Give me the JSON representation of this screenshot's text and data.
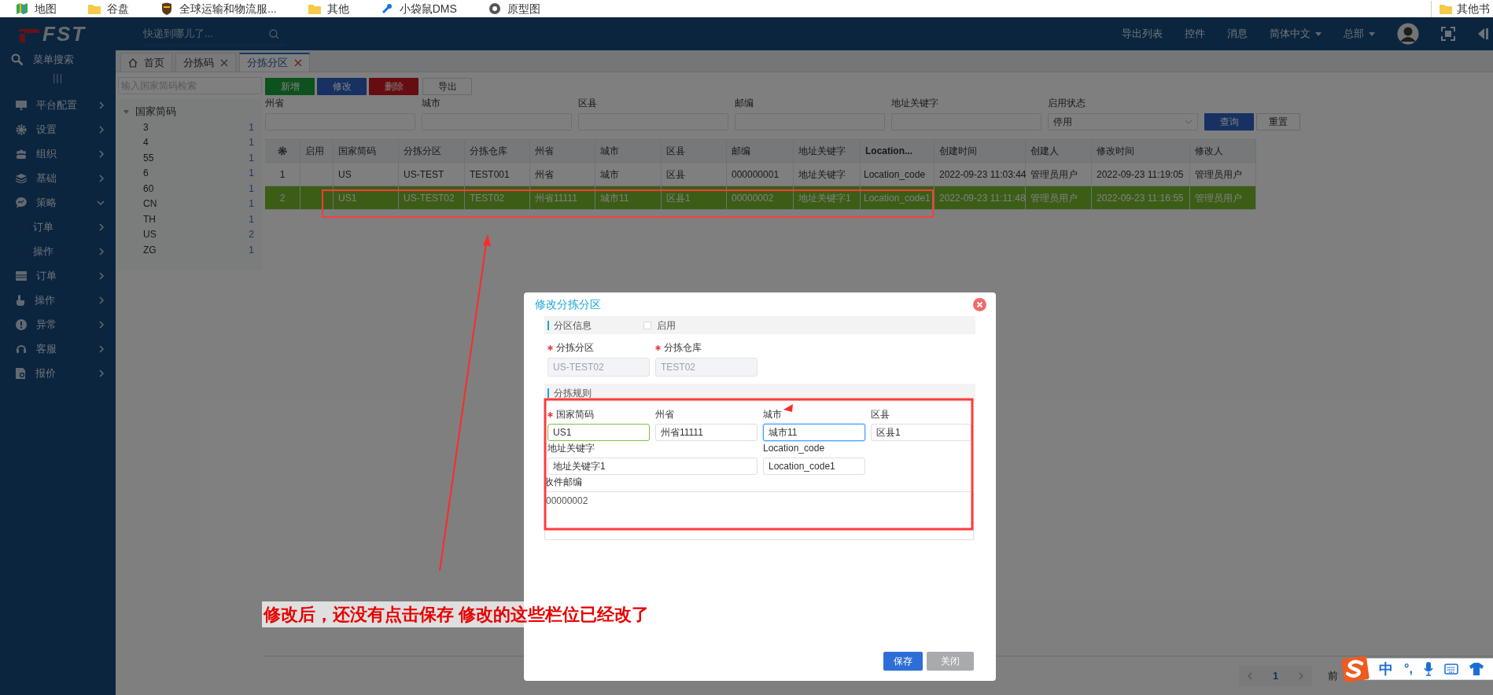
{
  "bookmarks": [
    {
      "label": "地图"
    },
    {
      "label": "谷盘"
    },
    {
      "label": "全球运输和物流服..."
    },
    {
      "label": "其他"
    },
    {
      "label": "小袋鼠DMS"
    },
    {
      "label": "原型图"
    }
  ],
  "bookmarks_right": {
    "label": "其他书"
  },
  "header": {
    "logo": "FST",
    "search_placeholder": "快递到哪儿了...",
    "links": [
      {
        "label": "导出列表",
        "dropdown": false
      },
      {
        "label": "控件",
        "dropdown": false
      },
      {
        "label": "消息",
        "dropdown": false
      },
      {
        "label": "简体中文",
        "dropdown": true
      },
      {
        "label": "总部",
        "dropdown": true
      }
    ]
  },
  "sidebar": {
    "search_label": "菜单搜索",
    "toggle": "|||",
    "items": [
      {
        "label": "平台配置",
        "expanded": false
      },
      {
        "label": "设置",
        "expanded": false
      },
      {
        "label": "组织",
        "expanded": false
      },
      {
        "label": "基础",
        "expanded": false
      },
      {
        "label": "策略",
        "expanded": true,
        "children": [
          {
            "label": "订单"
          },
          {
            "label": "操作"
          }
        ]
      },
      {
        "label": "订单",
        "expanded": false
      },
      {
        "label": "操作",
        "expanded": false
      },
      {
        "label": "异常",
        "expanded": false
      },
      {
        "label": "客服",
        "expanded": false
      },
      {
        "label": "报价",
        "expanded": false
      }
    ]
  },
  "tabs": [
    {
      "label": "首页",
      "selected": false,
      "kind": "home"
    },
    {
      "label": "分拣码",
      "selected": false,
      "kind": "closable"
    },
    {
      "label": "分拣分区",
      "selected": true,
      "kind": "closable"
    }
  ],
  "tree": {
    "search_placeholder": "输入国家简码检索",
    "root": {
      "label": "国家简码",
      "expanded": true,
      "children": [
        {
          "label": "3",
          "count": "1"
        },
        {
          "label": "4",
          "count": "1"
        },
        {
          "label": "55",
          "count": "1"
        },
        {
          "label": "6",
          "count": "1"
        },
        {
          "label": "60",
          "count": "1"
        },
        {
          "label": "CN",
          "count": "1"
        },
        {
          "label": "TH",
          "count": "1"
        },
        {
          "label": "US",
          "count": "2"
        },
        {
          "label": "ZG",
          "count": "1"
        }
      ]
    }
  },
  "toolbar": [
    {
      "label": "新增",
      "kind": "success"
    },
    {
      "label": "修改",
      "kind": "primary"
    },
    {
      "label": "删除",
      "kind": "danger"
    },
    {
      "label": "导出",
      "kind": "default"
    }
  ],
  "filters": [
    {
      "label": "州省",
      "kind": "text"
    },
    {
      "label": "城市",
      "kind": "text"
    },
    {
      "label": "区县",
      "kind": "text"
    },
    {
      "label": "邮编",
      "kind": "text"
    },
    {
      "label": "地址关键字",
      "kind": "text"
    },
    {
      "label": "启用状态",
      "kind": "select",
      "value": "停用"
    }
  ],
  "search_button": "查询",
  "reset_button": "重置",
  "table": {
    "columns": [
      "启用",
      "国家简码",
      "分拣分区",
      "分拣仓库",
      "州省",
      "城市",
      "区县",
      "邮编",
      "地址关键字",
      "Location...",
      "创建时间",
      "创建人",
      "修改时间",
      "修改人"
    ],
    "rows": [
      {
        "number": "1",
        "selected": false,
        "cells": [
          "",
          "US",
          "US-TEST",
          "TEST001",
          "州省",
          "城市",
          "区县",
          "000000001",
          "地址关键字",
          "Location_code",
          "2022-09-23 11:03:44",
          "管理员用户",
          "2022-09-23 11:19:05",
          "管理员用户"
        ]
      },
      {
        "number": "2",
        "selected": true,
        "cells": [
          "",
          "US1",
          "US-TEST02",
          "TEST02",
          "州省11111",
          "城市11",
          "区县1",
          "00000002",
          "地址关键字1",
          "Location_code1",
          "2022-09-23 11:11:48",
          "管理员用户",
          "2022-09-23 11:16:55",
          "管理员用户"
        ]
      }
    ]
  },
  "pagination": {
    "page": "1",
    "goto_label": "前"
  },
  "dialog": {
    "title": "修改分拣分区",
    "info_section": {
      "title": "分区信息",
      "enabled_label": "启用",
      "enabled": false
    },
    "info_fields": [
      {
        "label": "分拣分区",
        "required": true,
        "value": "US-TEST02",
        "disabled": true
      },
      {
        "label": "分拣仓库",
        "required": true,
        "value": "TEST02",
        "disabled": true
      }
    ],
    "rules_section": {
      "title": "分拣规则"
    },
    "rule_fields": [
      {
        "label": "国家简码",
        "required": true,
        "value": "US1",
        "kind": "text",
        "valid": true,
        "focused": false
      },
      {
        "label": "州省",
        "required": false,
        "value": "州省11111",
        "kind": "text",
        "valid": false,
        "focused": false
      },
      {
        "label": "城市",
        "required": false,
        "value": "城市11",
        "kind": "text",
        "valid": false,
        "focused": true
      },
      {
        "label": "区县",
        "required": false,
        "value": "区县1",
        "kind": "text",
        "valid": false,
        "focused": false
      },
      {
        "label": "地址关键字",
        "required": false,
        "value": "地址关键字1",
        "kind": "wide",
        "valid": false,
        "focused": false
      },
      {
        "label": "Location_code",
        "required": false,
        "value": "Location_code1",
        "kind": "text",
        "valid": false,
        "focused": false
      },
      {
        "label": "收件邮编",
        "required": false,
        "value": "00000002",
        "kind": "textarea",
        "valid": false,
        "focused": false
      }
    ],
    "buttons": [
      {
        "label": "保存",
        "kind": "primary"
      },
      {
        "label": "关闭",
        "kind": "secondary"
      }
    ]
  },
  "annotation": {
    "note": "修改后，还没有点击保存 修改的这些栏位已经改了"
  },
  "ime": {
    "mode": "中",
    "punct": "°,"
  }
}
